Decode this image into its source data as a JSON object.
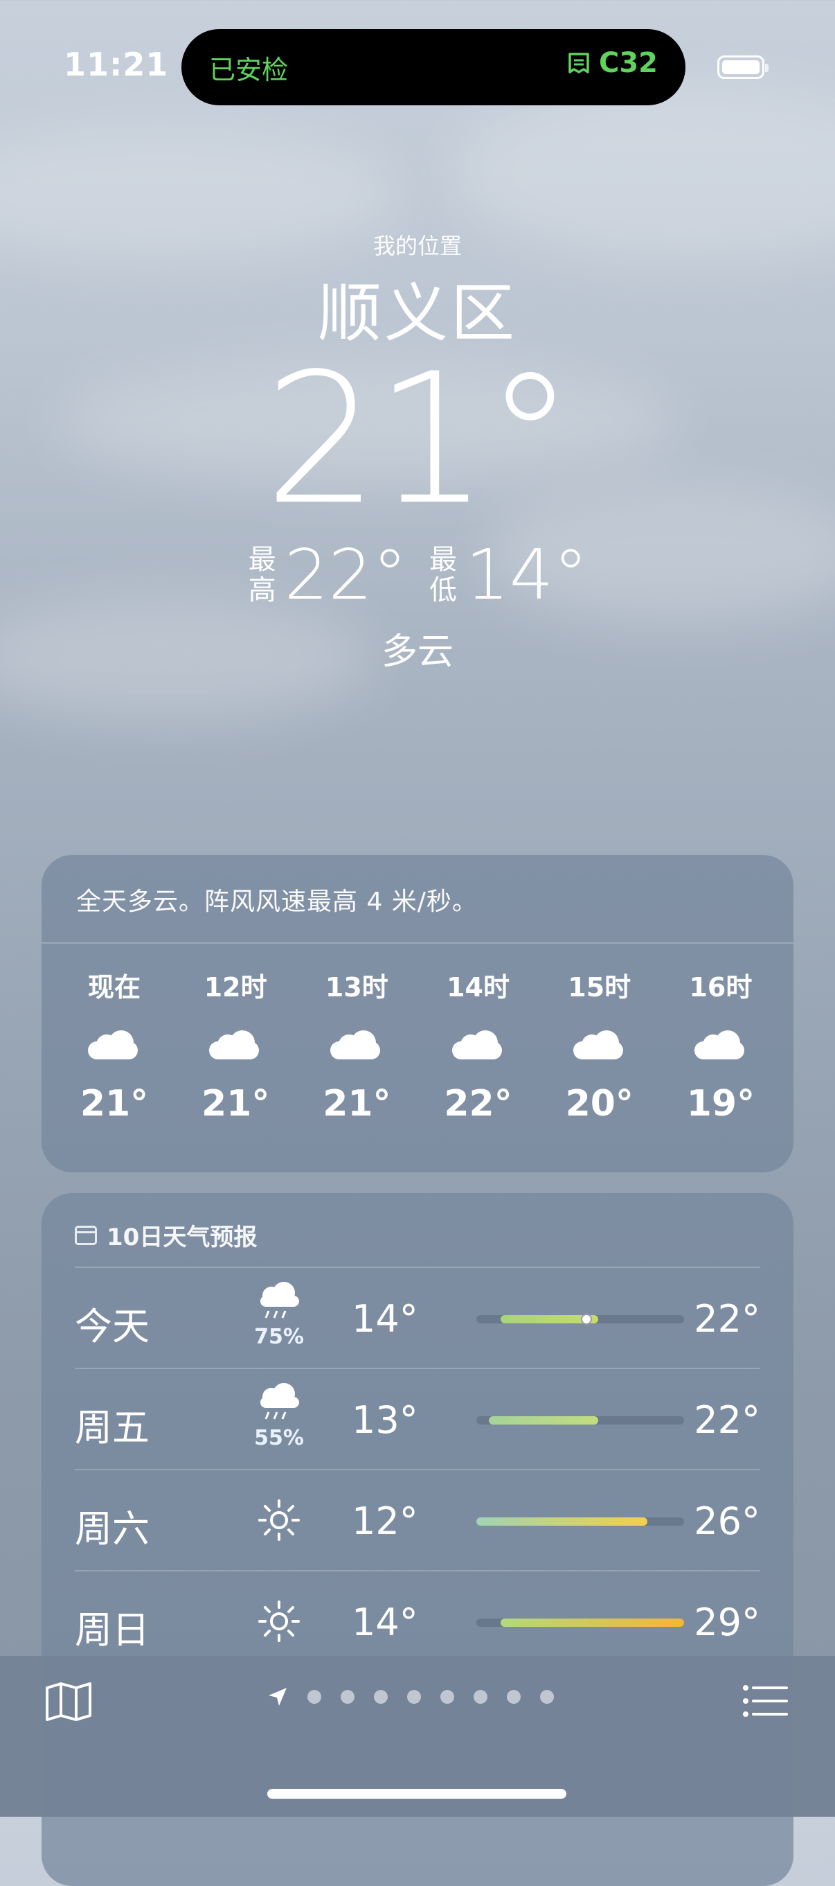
{
  "status": {
    "time": "11:21",
    "island_left": "已安检",
    "island_right": "C32"
  },
  "location": {
    "label": "我的位置",
    "city": "顺义区"
  },
  "current": {
    "temp": "21°",
    "high_label": "最高",
    "high": "22°",
    "low_label": "最低",
    "low": "14°",
    "condition": "多云"
  },
  "hourly": {
    "summary": "全天多云。阵风风速最高 4 米/秒。",
    "items": [
      {
        "time": "现在",
        "icon": "cloud-icon",
        "temp": "21°"
      },
      {
        "time": "12时",
        "icon": "cloud-icon",
        "temp": "21°"
      },
      {
        "time": "13时",
        "icon": "cloud-icon",
        "temp": "21°"
      },
      {
        "time": "14时",
        "icon": "cloud-icon",
        "temp": "22°"
      },
      {
        "time": "15时",
        "icon": "cloud-icon",
        "temp": "20°"
      },
      {
        "time": "16时",
        "icon": "cloud-icon",
        "temp": "19°"
      }
    ]
  },
  "daily": {
    "title": "10日天气预报",
    "range_min": 12,
    "range_max": 29,
    "days": [
      {
        "day": "今天",
        "icon": "rain-cloud-icon",
        "prob": "75%",
        "low": "14°",
        "high": "22°",
        "low_val": 14,
        "high_val": 22,
        "current_val": 21,
        "colors": [
          "#a9d37a",
          "#c6dc6b"
        ]
      },
      {
        "day": "周五",
        "icon": "rain-cloud-icon",
        "prob": "55%",
        "low": "13°",
        "high": "22°",
        "low_val": 13,
        "high_val": 22,
        "colors": [
          "#a6d39a",
          "#c3dc80"
        ]
      },
      {
        "day": "周六",
        "icon": "sun-icon",
        "prob": "",
        "low": "12°",
        "high": "26°",
        "low_val": 12,
        "high_val": 26,
        "colors": [
          "#9fd3b5",
          "#f3d04a"
        ]
      },
      {
        "day": "周日",
        "icon": "sun-icon",
        "prob": "",
        "low": "14°",
        "high": "29°",
        "low_val": 14,
        "high_val": 29,
        "colors": [
          "#b3d97c",
          "#f5b43a"
        ]
      }
    ]
  },
  "pager": {
    "pages": 8,
    "active": 0
  }
}
